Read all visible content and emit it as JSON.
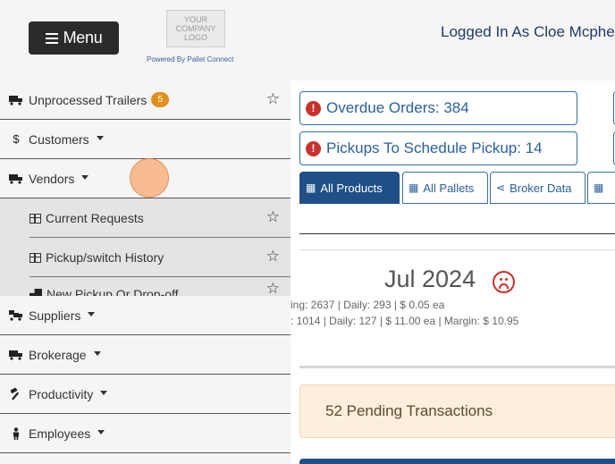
{
  "header": {
    "menu_label": "Menu",
    "logo_lines": [
      "YOUR",
      "COMPANY",
      "LOGO"
    ],
    "powered_by": "Powered By Pallet Connect",
    "logged_in": "Logged In As Cloe Mcphe"
  },
  "sidebar": {
    "items": [
      {
        "label": "Unprocessed Trailers",
        "icon": "truck-icon",
        "badge": "5"
      },
      {
        "label": "Customers",
        "icon": "dollar-icon"
      },
      {
        "label": "Vendors",
        "icon": "truck-icon"
      },
      {
        "label": "Suppliers",
        "icon": "truck-loading-icon"
      },
      {
        "label": "Brokerage",
        "icon": "truck-icon"
      },
      {
        "label": "Productivity",
        "icon": "hammer-icon"
      },
      {
        "label": "Employees",
        "icon": "person-icon"
      }
    ],
    "subitems": [
      {
        "label": "Current Requests",
        "icon": "table-icon"
      },
      {
        "label": "Pickup/switch History",
        "icon": "table-icon"
      },
      {
        "label": "New Pickup Or Drop-off",
        "icon": "truck-ramp-icon"
      }
    ]
  },
  "main": {
    "alerts": [
      {
        "label": "Overdue Orders: 384"
      },
      {
        "label": "Pickups To Schedule Pickup: 14"
      }
    ],
    "tabs": [
      {
        "label": "All Products",
        "active": true
      },
      {
        "label": "All Pallets",
        "active": false
      },
      {
        "label": "Broker Data",
        "active": false
      },
      {
        "label": "",
        "active": false
      }
    ],
    "month": "Jul 2024",
    "stats": [
      "ing: 2637 | Daily: 293 | $ 0.05 ea",
      ": 1014 | Daily: 127 | $ 11.00 ea | Margin: $ 10.95"
    ],
    "pending": "52 Pending Transactions"
  },
  "colors": {
    "primary": "#1f4f87",
    "alert_red": "#c9302c",
    "badge_orange": "#e0901a",
    "pending_bg": "#fcefdc"
  }
}
